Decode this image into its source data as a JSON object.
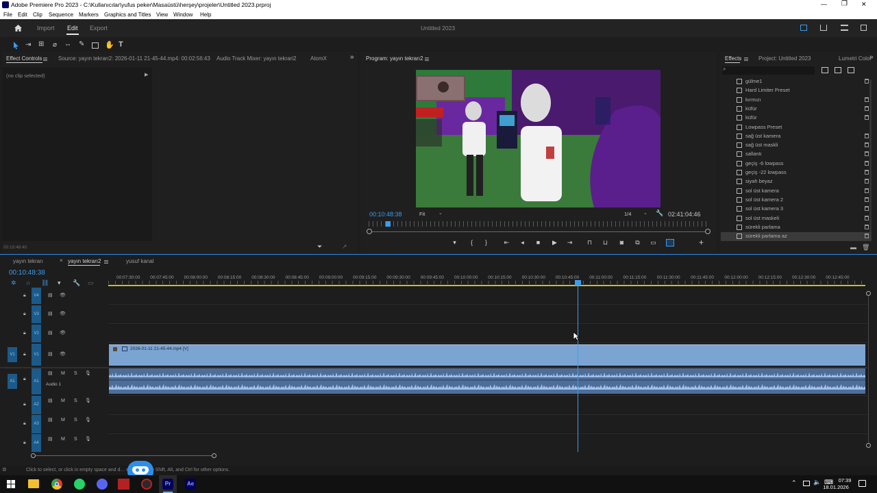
{
  "window": {
    "title": "Adobe Premiere Pro 2023 - C:\\Kullanıcılar\\yufus peker\\Masaüstü\\herşey\\projeler\\Untitled 2023.prproj",
    "minimize": "—",
    "maximize": "❐",
    "close": "✕"
  },
  "menu": [
    "File",
    "Edit",
    "Clip",
    "Sequence",
    "Markers",
    "Graphics and Titles",
    "View",
    "Window",
    "Help"
  ],
  "header": {
    "tabs": [
      "Import",
      "Edit",
      "Export"
    ],
    "active_tab": "Edit",
    "project_title": "Untitled 2023"
  },
  "source_panel": {
    "tabs": [
      "Effect Controls",
      "Source: yayın tekrarı2: 2026-01-11 21-45-44.mp4: 00:02:56:43",
      "Audio Track Mixer: yayın tekrari2",
      "AtomX"
    ],
    "empty_text": "(no clip selected)",
    "timecode": "00:10:48:40"
  },
  "program": {
    "title": "Program: yayın tekrarı2",
    "timecode": "00:10:48:38",
    "fit": "Fit",
    "resolution": "1/4",
    "duration": "02:41:04:46",
    "playhead_fraction": 0.057
  },
  "effects": {
    "tabs": [
      "Effects",
      "Project: Untitled 2023",
      "Lumetri Color"
    ],
    "items": [
      {
        "name": "gülme1",
        "deletable": true
      },
      {
        "name": "Hard Limiter Preset",
        "deletable": false
      },
      {
        "name": "kırmızı",
        "deletable": true
      },
      {
        "name": "küfür",
        "deletable": true
      },
      {
        "name": "küfür",
        "deletable": true
      },
      {
        "name": "Lowpass Preset",
        "deletable": false
      },
      {
        "name": "sağ üst kamera",
        "deletable": true
      },
      {
        "name": "sağ üst maskli",
        "deletable": true
      },
      {
        "name": "sallantı",
        "deletable": true
      },
      {
        "name": "geçiş -6 lowpass",
        "deletable": true
      },
      {
        "name": "geçiş -22 lowpass",
        "deletable": true
      },
      {
        "name": "siyah beyaz",
        "deletable": true
      },
      {
        "name": "sol üst kamera",
        "deletable": true
      },
      {
        "name": "sol üst kamera 2",
        "deletable": true
      },
      {
        "name": "sol üst kamera 3",
        "deletable": true
      },
      {
        "name": "sol üst maskeli",
        "deletable": true
      },
      {
        "name": "sürekli parlama",
        "deletable": true
      },
      {
        "name": "sürekli parlama az",
        "deletable": true,
        "selected": true
      }
    ]
  },
  "timeline": {
    "tabs": [
      "yayın tekrarı",
      "yayın tekrarı2",
      "yusuf kanal"
    ],
    "active_tab": "yayın tekrarı2",
    "timecode": "00:10:48:38",
    "ticks": [
      "00:07:30:00",
      "00:07:45:00",
      "00:08:00:00",
      "00:08:15:00",
      "00:08:30:00",
      "00:08:45:00",
      "00:09:00:00",
      "00:09:15:00",
      "00:09:30:00",
      "00:09:45:00",
      "00:10:00:00",
      "00:10:15:00",
      "00:10:30:00",
      "00:10:45:00",
      "00:11:00:00",
      "00:11:15:00",
      "00:11:30:00",
      "00:11:45:00",
      "00:12:00:00",
      "00:12:15:00",
      "00:12:30:00",
      "00:12:45:00"
    ],
    "video_tracks": [
      "V4",
      "V3",
      "V2",
      "V1"
    ],
    "audio_tracks": [
      "A1",
      "A2",
      "A3",
      "A4"
    ],
    "audio1_name": "Audio 1",
    "clip_name": "2026-01-11 21-45-44.mp4 [V]",
    "src_v1": "V1",
    "src_a1": "A1"
  },
  "status": {
    "text": "Click to select, or click in empty space and d… e select. Use Shift, Alt, and Ctrl for other options."
  },
  "taskbar": {
    "time": "07:39",
    "date": "18.01.2026",
    "apps": [
      "Pr",
      "Ae"
    ]
  },
  "colors": {
    "accent": "#2d8ceb",
    "clip_video": "#7ba4d2",
    "clip_audio": "#4e6d99",
    "playhead": "#3b9ded"
  }
}
